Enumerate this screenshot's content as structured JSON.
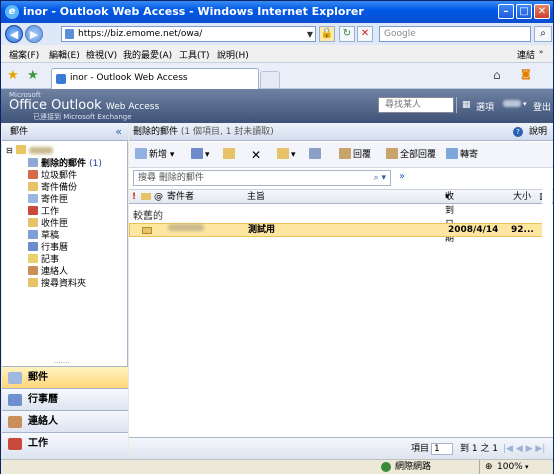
{
  "window": {
    "title": "inor - Outlook Web Access - Windows Internet Explorer"
  },
  "address": {
    "url": "https://biz.emome.net/owa/",
    "search_placeholder": "Google"
  },
  "menu": {
    "items": [
      "檔案(F)",
      "編輯(E)",
      "檢視(V)",
      "我的最愛(A)",
      "工具(T)",
      "說明(H)"
    ],
    "links": "連結"
  },
  "tab": {
    "title": "inor - Outlook Web Access"
  },
  "owa": {
    "logo_ms": "Microsoft",
    "logo_product": "Office Outlook",
    "logo_suffix": "Web Access",
    "logo_sub": "已連接到 Microsoft Exchange",
    "find_people": "尋找某人",
    "options": "選項",
    "logout": "登出"
  },
  "leftpane": {
    "header": "郵件",
    "folders": [
      {
        "label": "刪除的郵件",
        "count": "(1)"
      },
      {
        "label": "垃圾郵件"
      },
      {
        "label": "寄件備份"
      },
      {
        "label": "寄件匣"
      },
      {
        "label": "工作"
      },
      {
        "label": "收件匣"
      },
      {
        "label": "草稿"
      },
      {
        "label": "行事曆"
      },
      {
        "label": "記事"
      },
      {
        "label": "連絡人"
      },
      {
        "label": "搜尋資料夾"
      }
    ],
    "nav": [
      "郵件",
      "行事曆",
      "連絡人",
      "工作"
    ]
  },
  "main": {
    "folder_title": "刪除的郵件",
    "folder_info": "(1 個項目, 1 封未讀取)",
    "help": "說明",
    "toolbar": {
      "new": "新增",
      "reply": "回覆",
      "reply_all": "全部回覆",
      "forward": "轉寄"
    },
    "search_placeholder": "搜尋 刪除的郵件",
    "columns": {
      "from": "寄件者",
      "subject": "主旨",
      "received": "收到日期",
      "size": "大小"
    },
    "group": "較舊的",
    "rows": [
      {
        "subject": "測試用",
        "date": "2008/4/14",
        "size": "92..."
      }
    ],
    "footer": {
      "items": "項目",
      "page": "1",
      "of": "到 1 之 1"
    }
  },
  "status": {
    "zone": "網際網路",
    "zoom": "100%"
  }
}
